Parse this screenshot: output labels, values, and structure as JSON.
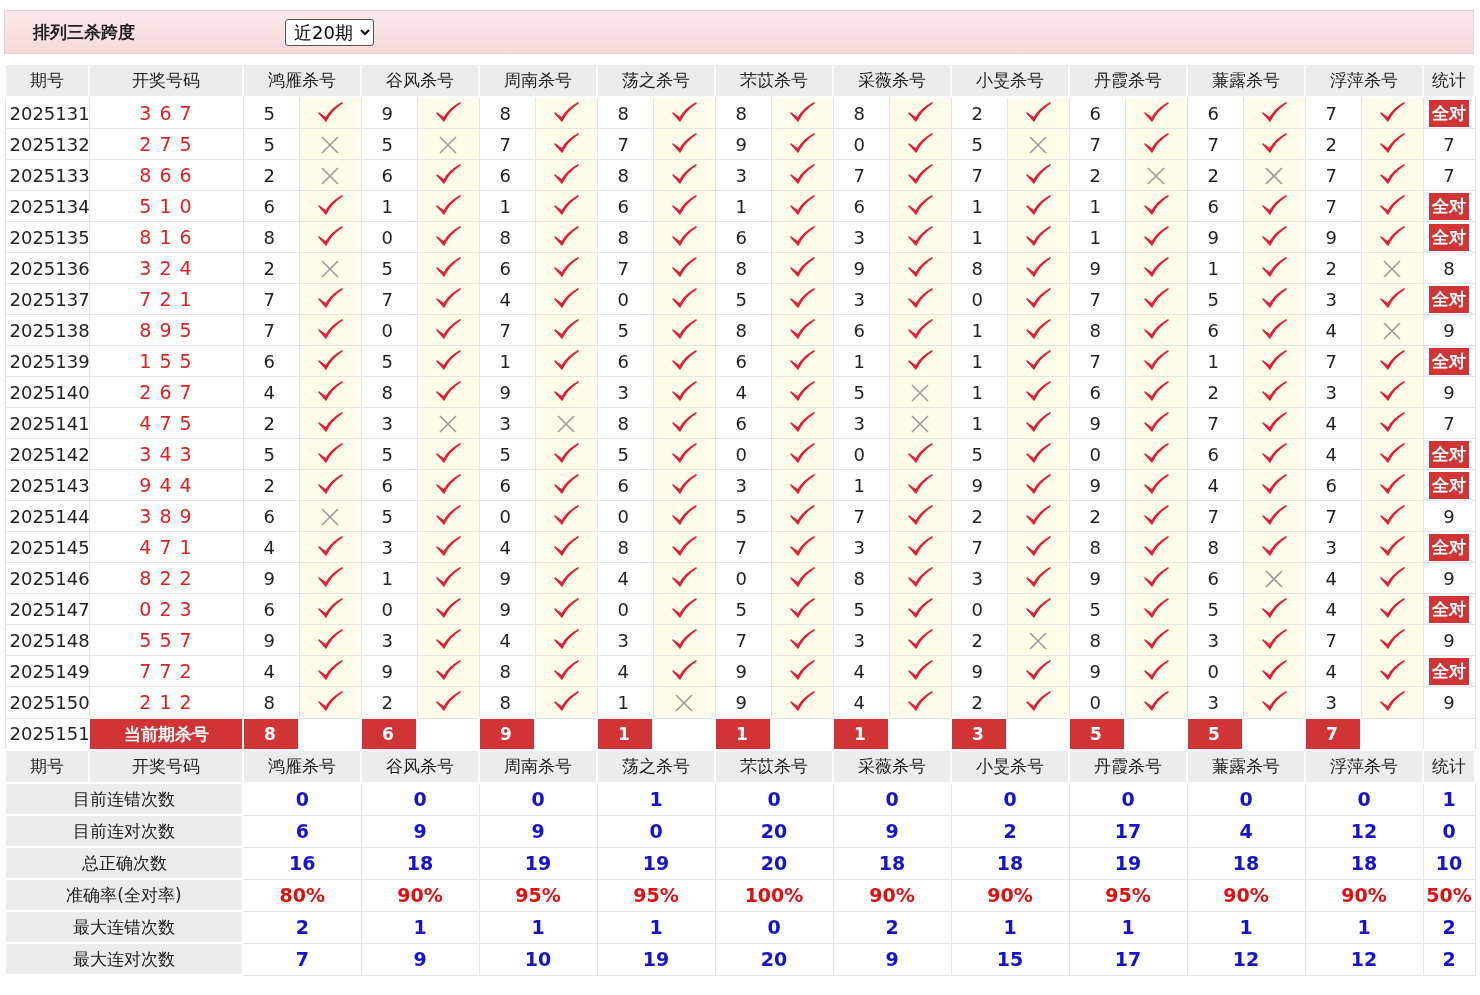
{
  "title": "排列三杀跨度",
  "range_select": {
    "value": "近20期"
  },
  "columns": [
    "期号",
    "开奖号码",
    "鸿雁杀号",
    "谷风杀号",
    "周南杀号",
    "荡之杀号",
    "芣苡杀号",
    "采薇杀号",
    "小旻杀号",
    "丹霞杀号",
    "蒹露杀号",
    "浮萍杀号",
    "统计"
  ],
  "rows": [
    {
      "period": "2025131",
      "numbers": "3 6 7",
      "picks": [
        {
          "value": "5",
          "correct": true
        },
        {
          "value": "9",
          "correct": true
        },
        {
          "value": "8",
          "correct": true
        },
        {
          "value": "8",
          "correct": true
        },
        {
          "value": "8",
          "correct": true
        },
        {
          "value": "8",
          "correct": true
        },
        {
          "value": "2",
          "correct": true
        },
        {
          "value": "6",
          "correct": true
        },
        {
          "value": "6",
          "correct": true
        },
        {
          "value": "7",
          "correct": true
        }
      ],
      "stat": {
        "text": "全对",
        "all_correct": true
      }
    },
    {
      "period": "2025132",
      "numbers": "2 7 5",
      "picks": [
        {
          "value": "5",
          "correct": false
        },
        {
          "value": "5",
          "correct": false
        },
        {
          "value": "7",
          "correct": true
        },
        {
          "value": "7",
          "correct": true
        },
        {
          "value": "9",
          "correct": true
        },
        {
          "value": "0",
          "correct": true
        },
        {
          "value": "5",
          "correct": false
        },
        {
          "value": "7",
          "correct": true
        },
        {
          "value": "7",
          "correct": true
        },
        {
          "value": "2",
          "correct": true
        }
      ],
      "stat": {
        "text": "7",
        "all_correct": false
      }
    },
    {
      "period": "2025133",
      "numbers": "8 6 6",
      "picks": [
        {
          "value": "2",
          "correct": false
        },
        {
          "value": "6",
          "correct": true
        },
        {
          "value": "6",
          "correct": true
        },
        {
          "value": "8",
          "correct": true
        },
        {
          "value": "3",
          "correct": true
        },
        {
          "value": "7",
          "correct": true
        },
        {
          "value": "7",
          "correct": true
        },
        {
          "value": "2",
          "correct": false
        },
        {
          "value": "2",
          "correct": false
        },
        {
          "value": "7",
          "correct": true
        }
      ],
      "stat": {
        "text": "7",
        "all_correct": false
      }
    },
    {
      "period": "2025134",
      "numbers": "5 1 0",
      "picks": [
        {
          "value": "6",
          "correct": true
        },
        {
          "value": "1",
          "correct": true
        },
        {
          "value": "1",
          "correct": true
        },
        {
          "value": "6",
          "correct": true
        },
        {
          "value": "1",
          "correct": true
        },
        {
          "value": "6",
          "correct": true
        },
        {
          "value": "1",
          "correct": true
        },
        {
          "value": "1",
          "correct": true
        },
        {
          "value": "6",
          "correct": true
        },
        {
          "value": "7",
          "correct": true
        }
      ],
      "stat": {
        "text": "全对",
        "all_correct": true
      }
    },
    {
      "period": "2025135",
      "numbers": "8 1 6",
      "picks": [
        {
          "value": "8",
          "correct": true
        },
        {
          "value": "0",
          "correct": true
        },
        {
          "value": "8",
          "correct": true
        },
        {
          "value": "8",
          "correct": true
        },
        {
          "value": "6",
          "correct": true
        },
        {
          "value": "3",
          "correct": true
        },
        {
          "value": "1",
          "correct": true
        },
        {
          "value": "1",
          "correct": true
        },
        {
          "value": "9",
          "correct": true
        },
        {
          "value": "9",
          "correct": true
        }
      ],
      "stat": {
        "text": "全对",
        "all_correct": true
      }
    },
    {
      "period": "2025136",
      "numbers": "3 2 4",
      "picks": [
        {
          "value": "2",
          "correct": false
        },
        {
          "value": "5",
          "correct": true
        },
        {
          "value": "6",
          "correct": true
        },
        {
          "value": "7",
          "correct": true
        },
        {
          "value": "8",
          "correct": true
        },
        {
          "value": "9",
          "correct": true
        },
        {
          "value": "8",
          "correct": true
        },
        {
          "value": "9",
          "correct": true
        },
        {
          "value": "1",
          "correct": true
        },
        {
          "value": "2",
          "correct": false
        }
      ],
      "stat": {
        "text": "8",
        "all_correct": false
      }
    },
    {
      "period": "2025137",
      "numbers": "7 2 1",
      "picks": [
        {
          "value": "7",
          "correct": true
        },
        {
          "value": "7",
          "correct": true
        },
        {
          "value": "4",
          "correct": true
        },
        {
          "value": "0",
          "correct": true
        },
        {
          "value": "5",
          "correct": true
        },
        {
          "value": "3",
          "correct": true
        },
        {
          "value": "0",
          "correct": true
        },
        {
          "value": "7",
          "correct": true
        },
        {
          "value": "5",
          "correct": true
        },
        {
          "value": "3",
          "correct": true
        }
      ],
      "stat": {
        "text": "全对",
        "all_correct": true
      }
    },
    {
      "period": "2025138",
      "numbers": "8 9 5",
      "picks": [
        {
          "value": "7",
          "correct": true
        },
        {
          "value": "0",
          "correct": true
        },
        {
          "value": "7",
          "correct": true
        },
        {
          "value": "5",
          "correct": true
        },
        {
          "value": "8",
          "correct": true
        },
        {
          "value": "6",
          "correct": true
        },
        {
          "value": "1",
          "correct": true
        },
        {
          "value": "8",
          "correct": true
        },
        {
          "value": "6",
          "correct": true
        },
        {
          "value": "4",
          "correct": false
        }
      ],
      "stat": {
        "text": "9",
        "all_correct": false
      }
    },
    {
      "period": "2025139",
      "numbers": "1 5 5",
      "picks": [
        {
          "value": "6",
          "correct": true
        },
        {
          "value": "5",
          "correct": true
        },
        {
          "value": "1",
          "correct": true
        },
        {
          "value": "6",
          "correct": true
        },
        {
          "value": "6",
          "correct": true
        },
        {
          "value": "1",
          "correct": true
        },
        {
          "value": "1",
          "correct": true
        },
        {
          "value": "7",
          "correct": true
        },
        {
          "value": "1",
          "correct": true
        },
        {
          "value": "7",
          "correct": true
        }
      ],
      "stat": {
        "text": "全对",
        "all_correct": true
      }
    },
    {
      "period": "2025140",
      "numbers": "2 6 7",
      "picks": [
        {
          "value": "4",
          "correct": true
        },
        {
          "value": "8",
          "correct": true
        },
        {
          "value": "9",
          "correct": true
        },
        {
          "value": "3",
          "correct": true
        },
        {
          "value": "4",
          "correct": true
        },
        {
          "value": "5",
          "correct": false
        },
        {
          "value": "1",
          "correct": true
        },
        {
          "value": "6",
          "correct": true
        },
        {
          "value": "2",
          "correct": true
        },
        {
          "value": "3",
          "correct": true
        }
      ],
      "stat": {
        "text": "9",
        "all_correct": false
      }
    },
    {
      "period": "2025141",
      "numbers": "4 7 5",
      "picks": [
        {
          "value": "2",
          "correct": true
        },
        {
          "value": "3",
          "correct": false
        },
        {
          "value": "3",
          "correct": false
        },
        {
          "value": "8",
          "correct": true
        },
        {
          "value": "6",
          "correct": true
        },
        {
          "value": "3",
          "correct": false
        },
        {
          "value": "1",
          "correct": true
        },
        {
          "value": "9",
          "correct": true
        },
        {
          "value": "7",
          "correct": true
        },
        {
          "value": "4",
          "correct": true
        }
      ],
      "stat": {
        "text": "7",
        "all_correct": false
      }
    },
    {
      "period": "2025142",
      "numbers": "3 4 3",
      "picks": [
        {
          "value": "5",
          "correct": true
        },
        {
          "value": "5",
          "correct": true
        },
        {
          "value": "5",
          "correct": true
        },
        {
          "value": "5",
          "correct": true
        },
        {
          "value": "0",
          "correct": true
        },
        {
          "value": "0",
          "correct": true
        },
        {
          "value": "5",
          "correct": true
        },
        {
          "value": "0",
          "correct": true
        },
        {
          "value": "6",
          "correct": true
        },
        {
          "value": "4",
          "correct": true
        }
      ],
      "stat": {
        "text": "全对",
        "all_correct": true
      }
    },
    {
      "period": "2025143",
      "numbers": "9 4 4",
      "picks": [
        {
          "value": "2",
          "correct": true
        },
        {
          "value": "6",
          "correct": true
        },
        {
          "value": "6",
          "correct": true
        },
        {
          "value": "6",
          "correct": true
        },
        {
          "value": "3",
          "correct": true
        },
        {
          "value": "1",
          "correct": true
        },
        {
          "value": "9",
          "correct": true
        },
        {
          "value": "9",
          "correct": true
        },
        {
          "value": "4",
          "correct": true
        },
        {
          "value": "6",
          "correct": true
        }
      ],
      "stat": {
        "text": "全对",
        "all_correct": true
      }
    },
    {
      "period": "2025144",
      "numbers": "3 8 9",
      "picks": [
        {
          "value": "6",
          "correct": false
        },
        {
          "value": "5",
          "correct": true
        },
        {
          "value": "0",
          "correct": true
        },
        {
          "value": "0",
          "correct": true
        },
        {
          "value": "5",
          "correct": true
        },
        {
          "value": "7",
          "correct": true
        },
        {
          "value": "2",
          "correct": true
        },
        {
          "value": "2",
          "correct": true
        },
        {
          "value": "7",
          "correct": true
        },
        {
          "value": "7",
          "correct": true
        }
      ],
      "stat": {
        "text": "9",
        "all_correct": false
      }
    },
    {
      "period": "2025145",
      "numbers": "4 7 1",
      "picks": [
        {
          "value": "4",
          "correct": true
        },
        {
          "value": "3",
          "correct": true
        },
        {
          "value": "4",
          "correct": true
        },
        {
          "value": "8",
          "correct": true
        },
        {
          "value": "7",
          "correct": true
        },
        {
          "value": "3",
          "correct": true
        },
        {
          "value": "7",
          "correct": true
        },
        {
          "value": "8",
          "correct": true
        },
        {
          "value": "8",
          "correct": true
        },
        {
          "value": "3",
          "correct": true
        }
      ],
      "stat": {
        "text": "全对",
        "all_correct": true
      }
    },
    {
      "period": "2025146",
      "numbers": "8 2 2",
      "picks": [
        {
          "value": "9",
          "correct": true
        },
        {
          "value": "1",
          "correct": true
        },
        {
          "value": "9",
          "correct": true
        },
        {
          "value": "4",
          "correct": true
        },
        {
          "value": "0",
          "correct": true
        },
        {
          "value": "8",
          "correct": true
        },
        {
          "value": "3",
          "correct": true
        },
        {
          "value": "9",
          "correct": true
        },
        {
          "value": "6",
          "correct": false
        },
        {
          "value": "4",
          "correct": true
        }
      ],
      "stat": {
        "text": "9",
        "all_correct": false
      }
    },
    {
      "period": "2025147",
      "numbers": "0 2 3",
      "picks": [
        {
          "value": "6",
          "correct": true
        },
        {
          "value": "0",
          "correct": true
        },
        {
          "value": "9",
          "correct": true
        },
        {
          "value": "0",
          "correct": true
        },
        {
          "value": "5",
          "correct": true
        },
        {
          "value": "5",
          "correct": true
        },
        {
          "value": "0",
          "correct": true
        },
        {
          "value": "5",
          "correct": true
        },
        {
          "value": "5",
          "correct": true
        },
        {
          "value": "4",
          "correct": true
        }
      ],
      "stat": {
        "text": "全对",
        "all_correct": true
      }
    },
    {
      "period": "2025148",
      "numbers": "5 5 7",
      "picks": [
        {
          "value": "9",
          "correct": true
        },
        {
          "value": "3",
          "correct": true
        },
        {
          "value": "4",
          "correct": true
        },
        {
          "value": "3",
          "correct": true
        },
        {
          "value": "7",
          "correct": true
        },
        {
          "value": "3",
          "correct": true
        },
        {
          "value": "2",
          "correct": false
        },
        {
          "value": "8",
          "correct": true
        },
        {
          "value": "3",
          "correct": true
        },
        {
          "value": "7",
          "correct": true
        }
      ],
      "stat": {
        "text": "9",
        "all_correct": false
      }
    },
    {
      "period": "2025149",
      "numbers": "7 7 2",
      "picks": [
        {
          "value": "4",
          "correct": true
        },
        {
          "value": "9",
          "correct": true
        },
        {
          "value": "8",
          "correct": true
        },
        {
          "value": "4",
          "correct": true
        },
        {
          "value": "9",
          "correct": true
        },
        {
          "value": "4",
          "correct": true
        },
        {
          "value": "9",
          "correct": true
        },
        {
          "value": "9",
          "correct": true
        },
        {
          "value": "0",
          "correct": true
        },
        {
          "value": "4",
          "correct": true
        }
      ],
      "stat": {
        "text": "全对",
        "all_correct": true
      }
    },
    {
      "period": "2025150",
      "numbers": "2 1 2",
      "picks": [
        {
          "value": "8",
          "correct": true
        },
        {
          "value": "2",
          "correct": true
        },
        {
          "value": "8",
          "correct": true
        },
        {
          "value": "1",
          "correct": false
        },
        {
          "value": "9",
          "correct": true
        },
        {
          "value": "4",
          "correct": true
        },
        {
          "value": "2",
          "correct": true
        },
        {
          "value": "0",
          "correct": true
        },
        {
          "value": "3",
          "correct": true
        },
        {
          "value": "3",
          "correct": true
        }
      ],
      "stat": {
        "text": "9",
        "all_correct": false
      }
    }
  ],
  "current": {
    "period": "2025151",
    "label": "当前期杀号",
    "picks": [
      "8",
      "6",
      "9",
      "1",
      "1",
      "1",
      "3",
      "5",
      "5",
      "7"
    ]
  },
  "footer_columns": [
    "期号",
    "开奖号码",
    "鸿雁杀号",
    "谷风杀号",
    "周南杀号",
    "荡之杀号",
    "芣苡杀号",
    "采薇杀号",
    "小旻杀号",
    "丹霞杀号",
    "蒹露杀号",
    "浮萍杀号",
    "统计"
  ],
  "stats": [
    {
      "label": "目前连错次数",
      "kind": "count",
      "values": [
        "0",
        "0",
        "0",
        "1",
        "0",
        "0",
        "0",
        "0",
        "0",
        "0",
        "1"
      ]
    },
    {
      "label": "目前连对次数",
      "kind": "count",
      "values": [
        "6",
        "9",
        "9",
        "0",
        "20",
        "9",
        "2",
        "17",
        "4",
        "12",
        "0"
      ]
    },
    {
      "label": "总正确次数",
      "kind": "count",
      "values": [
        "16",
        "18",
        "19",
        "19",
        "20",
        "18",
        "18",
        "19",
        "18",
        "18",
        "10"
      ]
    },
    {
      "label": "准确率(全对率)",
      "kind": "rate",
      "values": [
        "80%",
        "90%",
        "95%",
        "95%",
        "100%",
        "90%",
        "90%",
        "95%",
        "90%",
        "90%",
        "50%"
      ]
    },
    {
      "label": "最大连错次数",
      "kind": "count",
      "values": [
        "2",
        "1",
        "1",
        "1",
        "0",
        "2",
        "1",
        "1",
        "1",
        "1",
        "2"
      ]
    },
    {
      "label": "最大连对次数",
      "kind": "count",
      "values": [
        "7",
        "9",
        "10",
        "19",
        "20",
        "9",
        "15",
        "17",
        "12",
        "12",
        "2"
      ]
    }
  ]
}
